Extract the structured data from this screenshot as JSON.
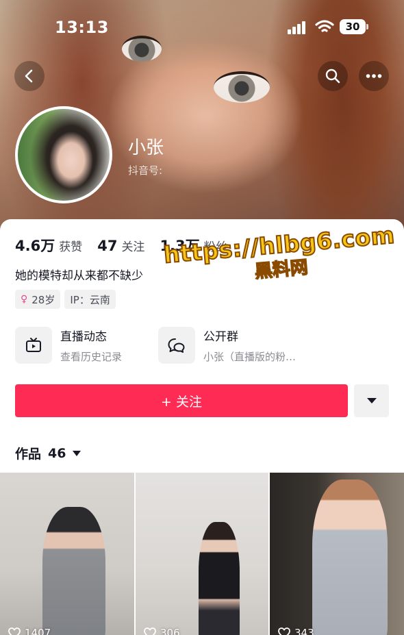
{
  "status_bar": {
    "time": "13:13",
    "battery": "30"
  },
  "profile": {
    "username": "小张",
    "douyin_id_label": "抖音号:",
    "stats": [
      {
        "value": "4.6万",
        "label": "获赞"
      },
      {
        "value": "47",
        "label": "关注"
      },
      {
        "value": "1.3万",
        "label": "粉丝"
      }
    ],
    "bio": "她的模特却从来都不缺少",
    "tags": {
      "age": "28岁",
      "ip": "IP：云南"
    }
  },
  "features": {
    "live": {
      "title": "直播动态",
      "subtitle": "查看历史记录"
    },
    "group": {
      "title": "公开群",
      "subtitle": "小张（直播版的粉…"
    }
  },
  "actions": {
    "follow_label": "+ 关注"
  },
  "works": {
    "label": "作品",
    "count": "46",
    "items": [
      {
        "likes": "1407"
      },
      {
        "likes": "306"
      },
      {
        "likes": "343"
      }
    ]
  },
  "watermark": {
    "url": "https://hlbg6.com",
    "name": "黑料网"
  },
  "colors": {
    "accent": "#fe2c55",
    "watermark": "#f5c518"
  },
  "icons": [
    "back-icon",
    "search-icon",
    "more-icon",
    "tv-icon",
    "chat-icon",
    "caret-down-icon",
    "heart-icon",
    "female-icon"
  ]
}
